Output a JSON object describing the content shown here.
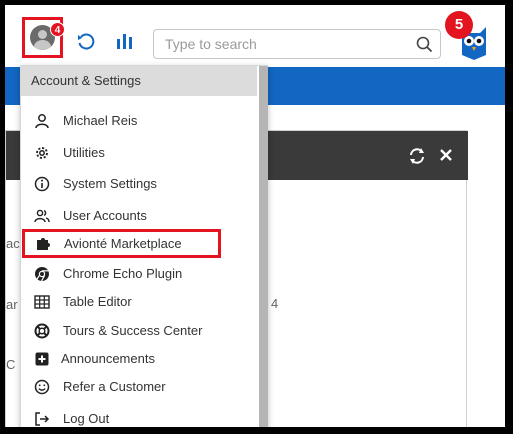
{
  "header": {
    "avatar_badge": "4",
    "search": {
      "placeholder": "Type to search"
    },
    "notifications_badge": "5"
  },
  "menu": {
    "title": "Account & Settings",
    "items": [
      {
        "label": "Michael Reis",
        "icon": "user-icon"
      },
      {
        "label": "Utilities",
        "icon": "gear-icon"
      },
      {
        "label": "System Settings",
        "icon": "info-icon"
      },
      {
        "label": "User Accounts",
        "icon": "users-icon"
      },
      {
        "label": "Avionté Marketplace",
        "icon": "puzzle-icon"
      },
      {
        "label": "Chrome Echo Plugin",
        "icon": "chrome-icon"
      },
      {
        "label": "Table Editor",
        "icon": "table-icon"
      },
      {
        "label": "Tours & Success Center",
        "icon": "lifebuoy-icon"
      },
      {
        "label": "Announcements",
        "icon": "plus-square-icon"
      },
      {
        "label": "Refer a Customer",
        "icon": "smile-icon"
      },
      {
        "label": "Log Out",
        "icon": "logout-icon"
      }
    ]
  },
  "background": {
    "fragments": [
      "ac",
      "ar",
      "4",
      "C"
    ]
  },
  "colors": {
    "accent_red": "#e3141f",
    "nav_blue": "#1167c1",
    "card_header": "#3a3a3a"
  }
}
